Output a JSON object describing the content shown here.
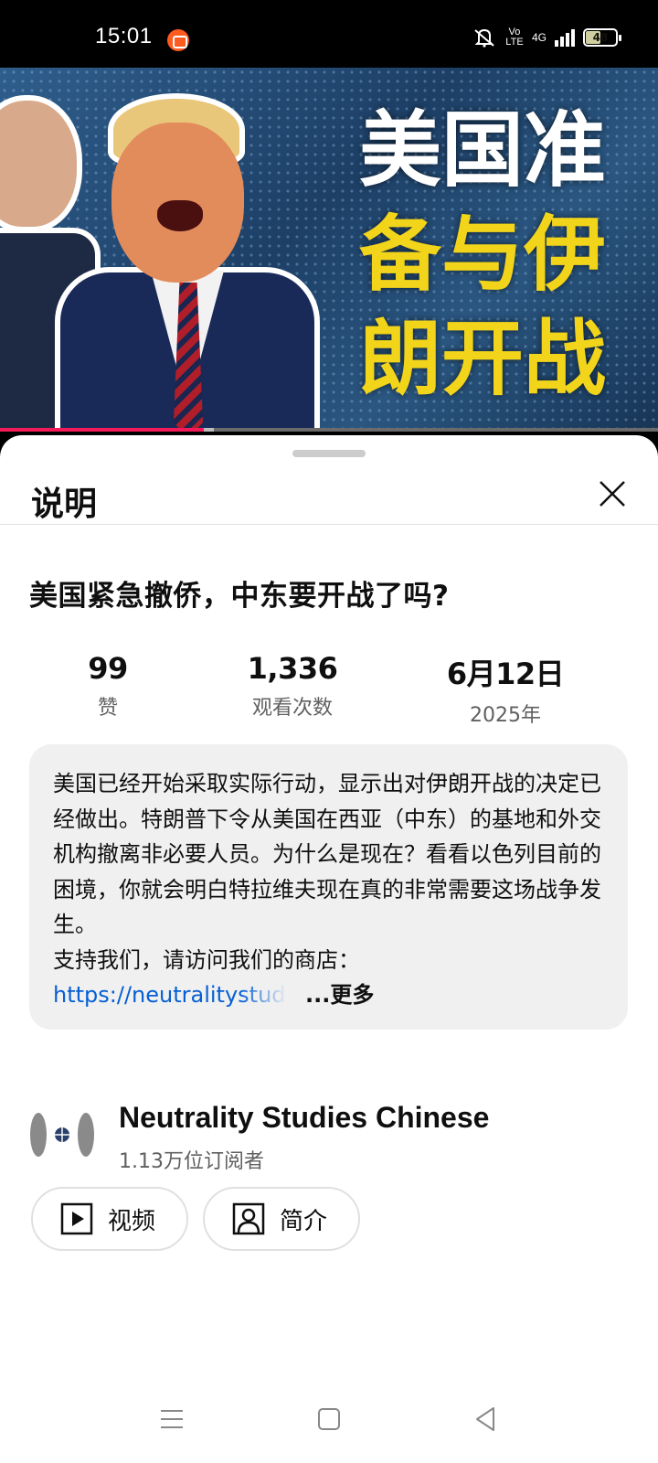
{
  "status_bar": {
    "time": "15:01",
    "network": "4G",
    "volte": "Vo LTE",
    "battery": "48",
    "icons": [
      "recorder-icon",
      "mute-icon",
      "signal-icon",
      "battery-icon"
    ]
  },
  "video": {
    "thumbnail_text": [
      "美国准",
      "备与伊",
      "朗开战"
    ],
    "progress_fraction": 0.31
  },
  "sheet": {
    "title": "说明",
    "video_title": "美国紧急撤侨，中东要开战了吗?",
    "stats": {
      "likes_value": "99",
      "likes_label": "赞",
      "views_value": "1,336",
      "views_label": "观看次数",
      "date_value": "6月12日",
      "date_label": "2025年"
    },
    "description": {
      "text": "美国已经开始采取实际行动，显示出对伊朗开战的决定已经做出。特朗普下令从美国在西亚（中东）的基地和外交机构撤离非必要人员。为什么是现在？看看以色列目前的困境，你就会明白特拉维夫现在真的非常需要这场战争发生。\n支持我们，请访问我们的商店：",
      "link": "https://neutralitystudies",
      "more_label": "...更多"
    },
    "channel": {
      "name": "Neutrality Studies Chinese",
      "subscribers": "1.13万位订阅者"
    },
    "buttons": {
      "videos_label": "视频",
      "about_label": "简介"
    }
  },
  "colors": {
    "accent_red": "#f51b58",
    "link_blue": "#065fd4",
    "thumb_yellow": "#f2d51b"
  }
}
